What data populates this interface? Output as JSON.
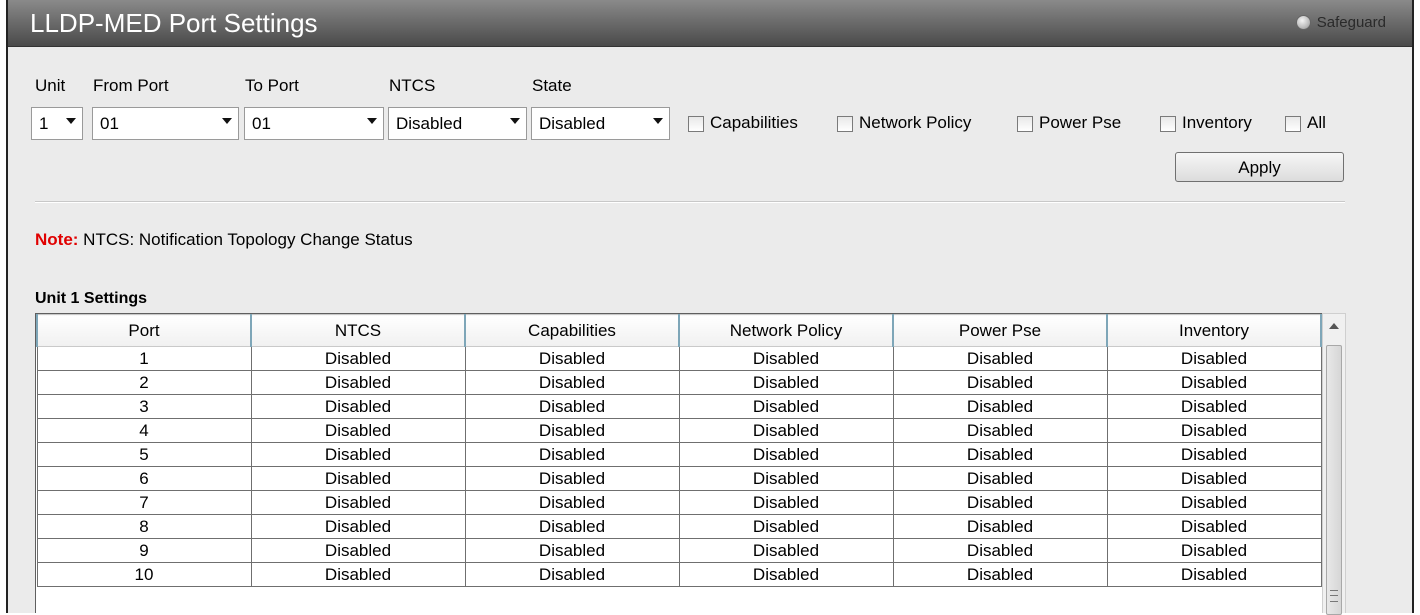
{
  "header": {
    "title": "LLDP-MED Port Settings",
    "safeguard_label": "Safeguard"
  },
  "form": {
    "unit_label": "Unit",
    "unit_value": "1",
    "from_port_label": "From Port",
    "from_port_value": "01",
    "to_port_label": "To Port",
    "to_port_value": "01",
    "ntcs_label": "NTCS",
    "ntcs_value": "Disabled",
    "state_label": "State",
    "state_value": "Disabled",
    "checkboxes": [
      "Capabilities",
      "Network Policy",
      "Power Pse",
      "Inventory",
      "All"
    ],
    "apply_label": "Apply"
  },
  "note": {
    "prefix": "Note:",
    "text": " NTCS: Notification Topology Change Status"
  },
  "table": {
    "section_title": "Unit 1 Settings",
    "columns": [
      "Port",
      "NTCS",
      "Capabilities",
      "Network Policy",
      "Power Pse",
      "Inventory"
    ],
    "rows": [
      [
        "1",
        "Disabled",
        "Disabled",
        "Disabled",
        "Disabled",
        "Disabled"
      ],
      [
        "2",
        "Disabled",
        "Disabled",
        "Disabled",
        "Disabled",
        "Disabled"
      ],
      [
        "3",
        "Disabled",
        "Disabled",
        "Disabled",
        "Disabled",
        "Disabled"
      ],
      [
        "4",
        "Disabled",
        "Disabled",
        "Disabled",
        "Disabled",
        "Disabled"
      ],
      [
        "5",
        "Disabled",
        "Disabled",
        "Disabled",
        "Disabled",
        "Disabled"
      ],
      [
        "6",
        "Disabled",
        "Disabled",
        "Disabled",
        "Disabled",
        "Disabled"
      ],
      [
        "7",
        "Disabled",
        "Disabled",
        "Disabled",
        "Disabled",
        "Disabled"
      ],
      [
        "8",
        "Disabled",
        "Disabled",
        "Disabled",
        "Disabled",
        "Disabled"
      ],
      [
        "9",
        "Disabled",
        "Disabled",
        "Disabled",
        "Disabled",
        "Disabled"
      ],
      [
        "10",
        "Disabled",
        "Disabled",
        "Disabled",
        "Disabled",
        "Disabled"
      ]
    ]
  },
  "colors": {
    "note_accent": "#e00000",
    "title_bar": "#6d6d6d"
  },
  "icons": {
    "safeguard": "radio-indicator-icon",
    "dropdown": "chevron-down-icon",
    "scroll_up": "arrow-up-icon"
  }
}
